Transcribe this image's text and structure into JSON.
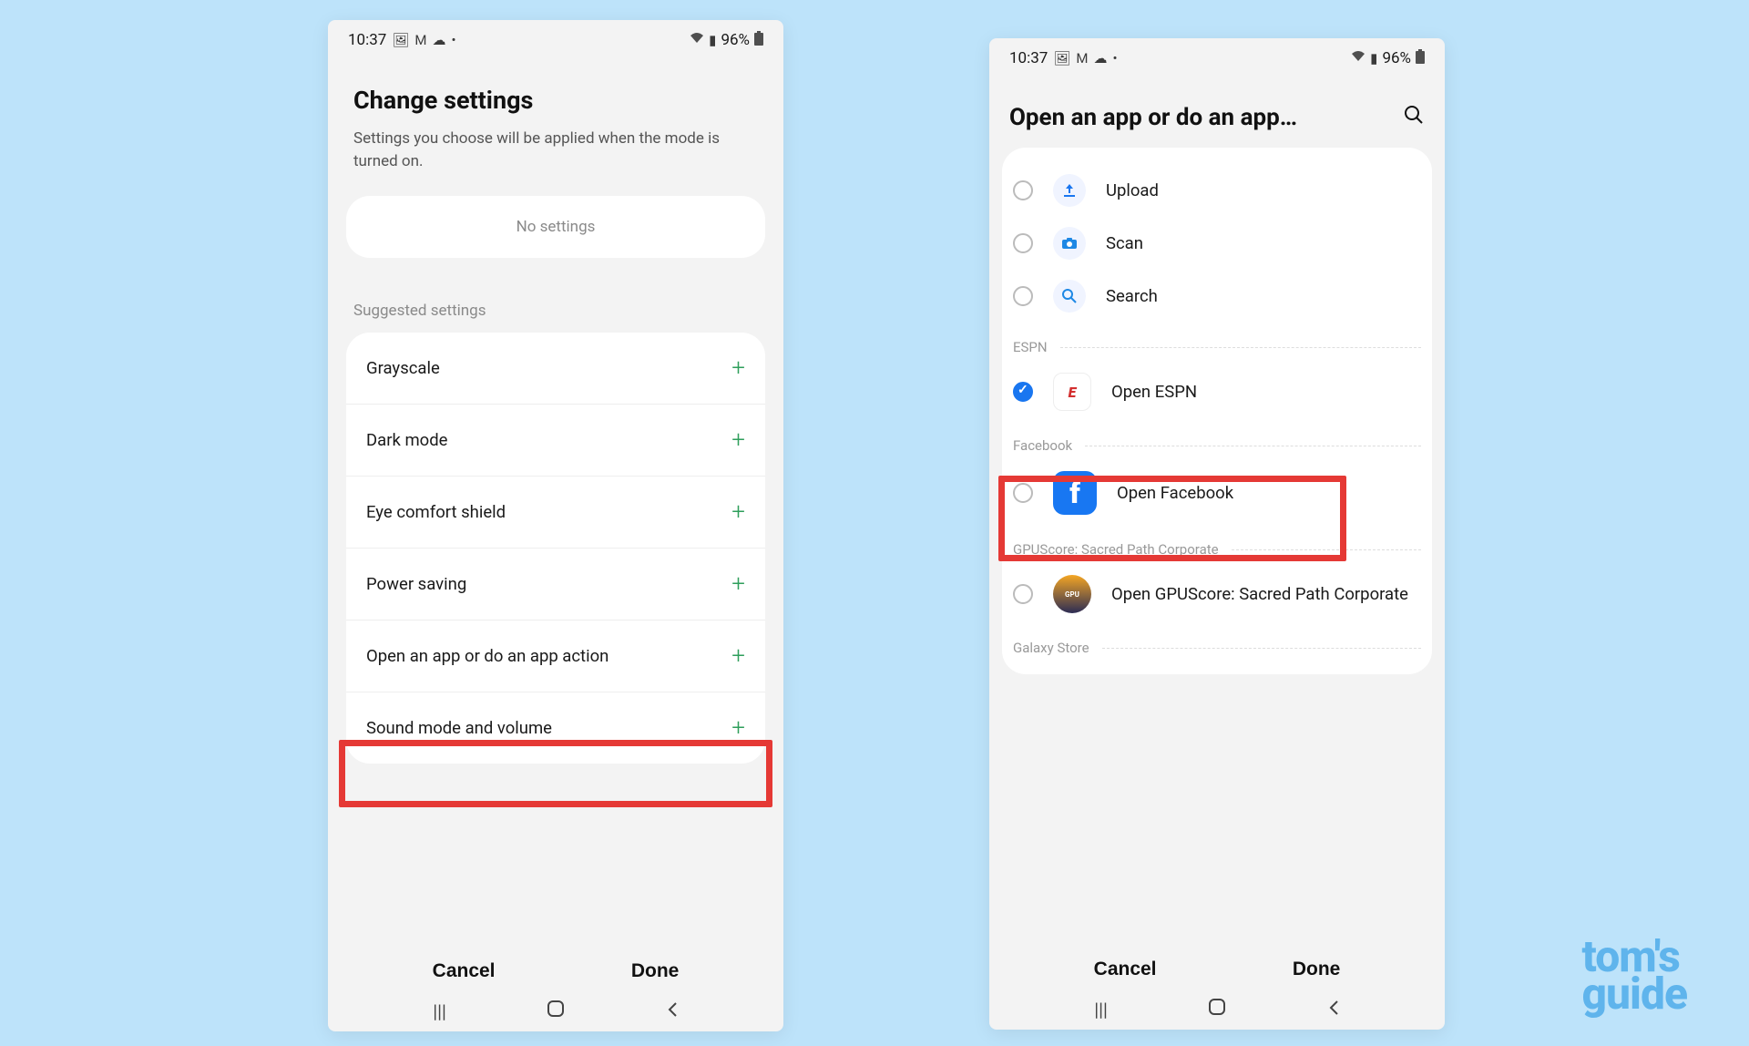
{
  "status_bar": {
    "time": "10:37",
    "icons_left": [
      "image-icon",
      "gmail-icon",
      "cloud-icon",
      "dot-icon"
    ],
    "battery": "96%",
    "icons_right": [
      "wifi-icon",
      "signal-icon"
    ]
  },
  "left_screen": {
    "title": "Change settings",
    "subtitle": "Settings you choose will be applied when the mode is turned on.",
    "no_settings": "No settings",
    "section_label": "Suggested settings",
    "rows": [
      {
        "label": "Grayscale"
      },
      {
        "label": "Dark mode"
      },
      {
        "label": "Eye comfort shield"
      },
      {
        "label": "Power saving"
      },
      {
        "label": "Open an app or do an app action"
      },
      {
        "label": "Sound mode and volume"
      }
    ],
    "cancel": "Cancel",
    "done": "Done"
  },
  "right_screen": {
    "title": "Open an app or do an app…",
    "items": [
      {
        "label": "Upload",
        "icon": "upload-icon",
        "checked": false
      },
      {
        "label": "Scan",
        "icon": "camera-icon",
        "checked": false
      },
      {
        "label": "Search",
        "icon": "search-icon",
        "checked": false
      }
    ],
    "groups": [
      {
        "name": "ESPN",
        "rows": [
          {
            "label": "Open ESPN",
            "icon": "espn-icon",
            "checked": true
          }
        ]
      },
      {
        "name": "Facebook",
        "rows": [
          {
            "label": "Open Facebook",
            "icon": "facebook-icon",
            "checked": false
          }
        ]
      },
      {
        "name": "GPUScore: Sacred Path Corporate",
        "rows": [
          {
            "label": "Open GPUScore: Sacred Path Corporate",
            "icon": "gpuscore-icon",
            "checked": false
          }
        ]
      },
      {
        "name": "Galaxy Store",
        "rows": []
      }
    ],
    "cancel": "Cancel",
    "done": "Done"
  },
  "watermark": {
    "line1": "tom's",
    "line2": "guide"
  }
}
